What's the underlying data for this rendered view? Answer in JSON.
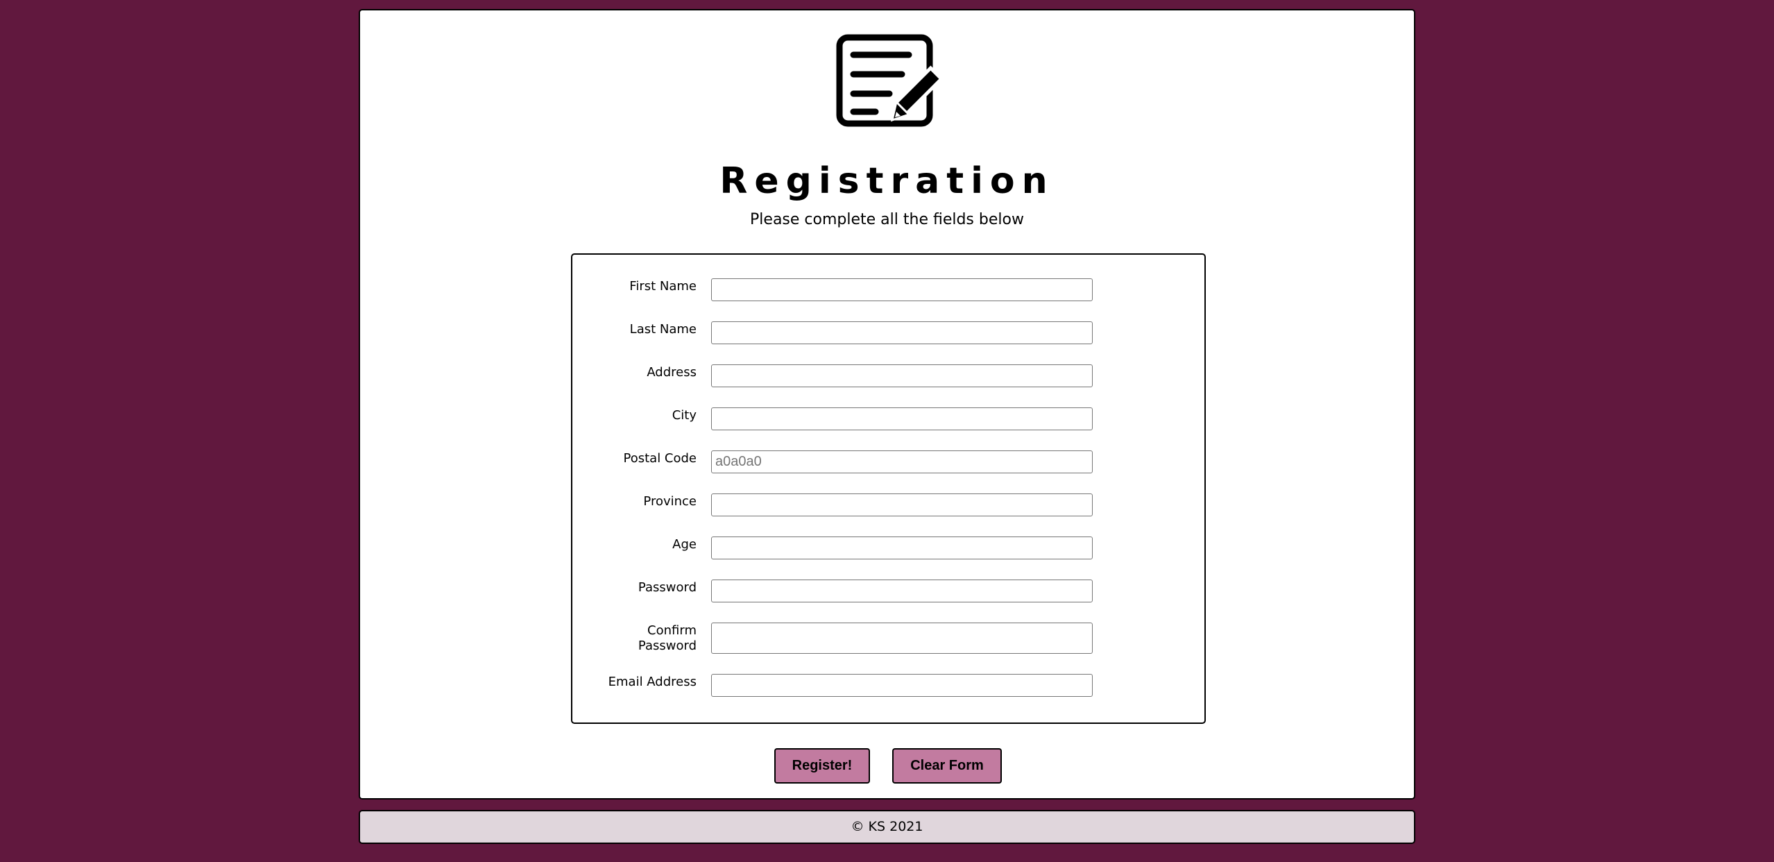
{
  "header": {
    "icon": "form-edit-icon",
    "title": "Registration",
    "subtitle": "Please complete all the fields below"
  },
  "form": {
    "fields": [
      {
        "label": "First Name",
        "value": "",
        "placeholder": ""
      },
      {
        "label": "Last Name",
        "value": "",
        "placeholder": ""
      },
      {
        "label": "Address",
        "value": "",
        "placeholder": ""
      },
      {
        "label": "City",
        "value": "",
        "placeholder": ""
      },
      {
        "label": "Postal Code",
        "value": "",
        "placeholder": "a0a0a0"
      },
      {
        "label": "Province",
        "value": "",
        "placeholder": ""
      },
      {
        "label": "Age",
        "value": "",
        "placeholder": ""
      },
      {
        "label": "Password",
        "value": "",
        "placeholder": ""
      },
      {
        "label": "Confirm Password",
        "value": "",
        "placeholder": ""
      },
      {
        "label": "Email Address",
        "value": "",
        "placeholder": ""
      }
    ]
  },
  "buttons": {
    "register_label": "Register!",
    "clear_label": "Clear Form"
  },
  "footer": {
    "text": "© KS 2021"
  },
  "colors": {
    "background": "#61183e",
    "button": "#c27ba0",
    "footer": "#e0d6dc"
  }
}
